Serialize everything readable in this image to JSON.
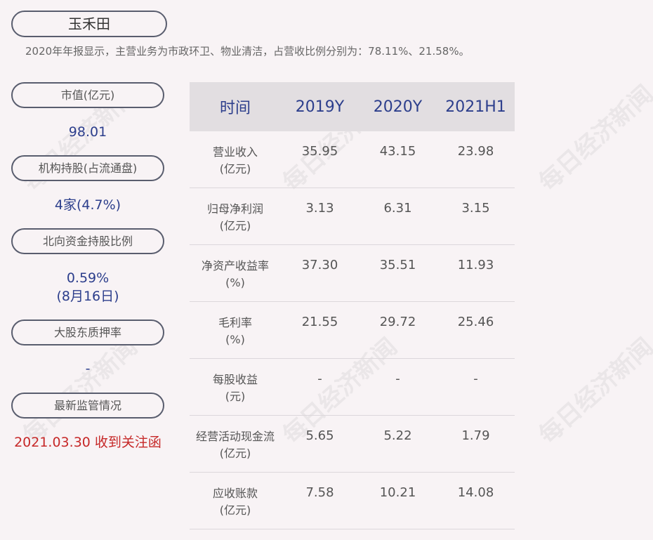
{
  "company": "玉禾田",
  "summary": "2020年年报显示，主营业务为市政环卫、物业清洁，占营收比例分别为：78.11%、21.58%。",
  "sidebar": {
    "market_cap_label": "市值(亿元)",
    "market_cap_value": "98.01",
    "institution_label": "机构持股(占流通盘)",
    "institution_value": "4家(4.7%)",
    "northbound_label": "北向资金持股比例",
    "northbound_value": "0.59%",
    "northbound_date": "(8月16日)",
    "pledge_label": "大股东质押率",
    "pledge_value": "-",
    "regulation_label": "最新监管情况",
    "regulation_value": "2021.03.30 收到关注函"
  },
  "table": {
    "headers": [
      "时间",
      "2019Y",
      "2020Y",
      "2021H1"
    ],
    "rows": [
      {
        "metric": "营业收入",
        "unit": "(亿元)",
        "values": [
          "35.95",
          "43.15",
          "23.98"
        ]
      },
      {
        "metric": "归母净利润",
        "unit": "(亿元)",
        "values": [
          "3.13",
          "6.31",
          "3.15"
        ]
      },
      {
        "metric": "净资产收益率",
        "unit": "(%)",
        "values": [
          "37.30",
          "35.51",
          "11.93"
        ]
      },
      {
        "metric": "毛利率",
        "unit": "(%)",
        "values": [
          "21.55",
          "29.72",
          "25.46"
        ]
      },
      {
        "metric": "每股收益",
        "unit": "(元)",
        "values": [
          "-",
          "-",
          "-"
        ]
      },
      {
        "metric": "经营活动现金流",
        "unit": "(亿元)",
        "values": [
          "5.65",
          "5.22",
          "1.79"
        ]
      },
      {
        "metric": "应收账款",
        "unit": "(亿元)",
        "values": [
          "7.58",
          "10.21",
          "14.08"
        ]
      }
    ]
  },
  "watermark": "每日经济新闻",
  "colors": {
    "value_blue": "#2c3e8c",
    "alert_red": "#c62828",
    "background": "#f8f3f5"
  }
}
